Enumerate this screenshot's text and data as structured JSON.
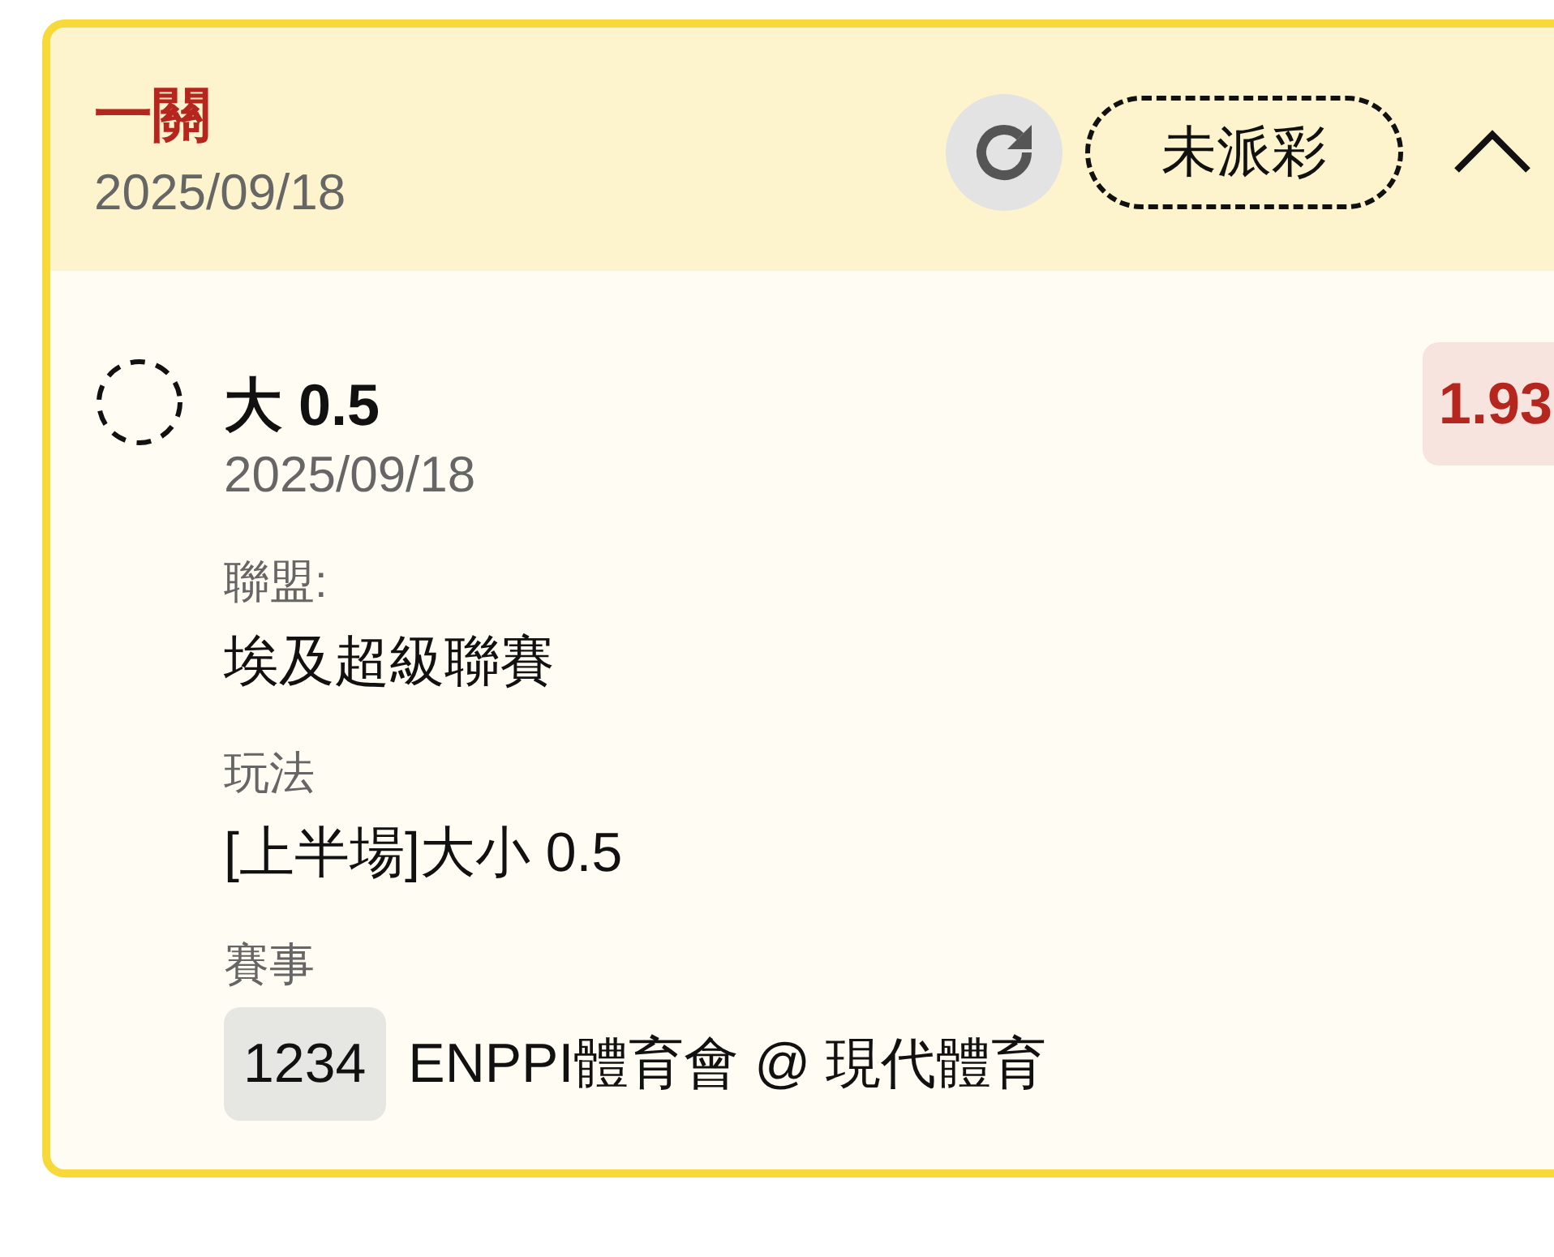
{
  "bet": {
    "title": "一關",
    "date": "2025/09/18",
    "status": "未派彩",
    "expanded": true
  },
  "selections": [
    {
      "pick": "大 0.5",
      "date": "2025/09/18",
      "odds": "1.93",
      "fields": [
        {
          "label": "聯盟:",
          "value": "埃及超級聯賽"
        },
        {
          "label": "玩法",
          "value": "[上半場]大小 0.5"
        },
        {
          "label": "賽事",
          "code": "1234",
          "value": "ENPPI體育會 @ 現代體育"
        }
      ]
    }
  ]
}
